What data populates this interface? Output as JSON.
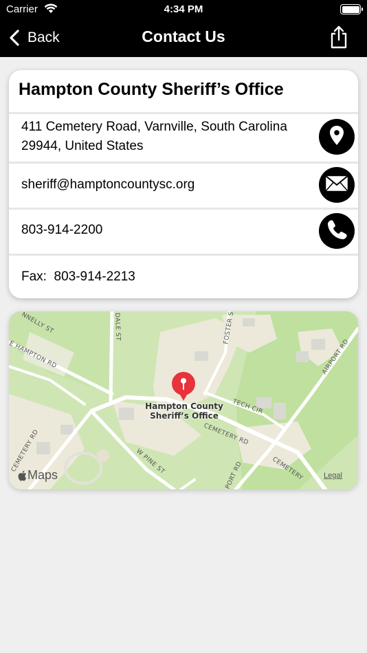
{
  "status_bar": {
    "carrier": "Carrier",
    "time": "4:34 PM"
  },
  "nav": {
    "back_label": "Back",
    "title": "Contact Us"
  },
  "contact": {
    "name": "Hampton County Sheriff’s Office",
    "address_line1": "411 Cemetery Road, Varnville, South Carolina",
    "address_line2": "29944, United States",
    "email": "sheriff@hamptoncountysc.org",
    "phone": "803-914-2200",
    "fax_label": "Fax:",
    "fax": "803-914-2213"
  },
  "map": {
    "poi_line1": "Hampton County",
    "poi_line2": "Sheriff’s Office",
    "roads": {
      "nnelly": "NNELLY ST",
      "hampton": "E HAMPTON RD",
      "dale": "DALE ST",
      "foster": "FOSTER ST",
      "airport": "AIRPORT RD",
      "tech": "TECH CIR",
      "cemetery": "CEMETERY RD",
      "cemetery_left": "CEMETERY RD",
      "cemetery_right": "CEMETERY",
      "pine": "W PINE ST",
      "port": "PORT RD"
    },
    "brand": "Maps",
    "legal": "Legal"
  },
  "colors": {
    "nav_background": "#000000",
    "page_background": "#efefef",
    "pin": "#e8323c",
    "map_green": "#cfe6b4"
  },
  "icons": {
    "back": "chevron-left-icon",
    "share": "share-icon",
    "location": "location-pin-icon",
    "email": "envelope-icon",
    "phone": "phone-icon"
  }
}
